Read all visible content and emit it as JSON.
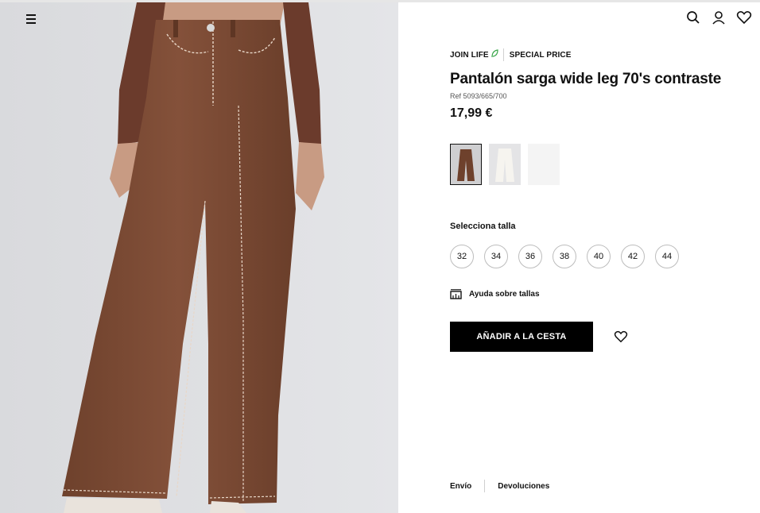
{
  "header": {
    "menu_icon": "hamburger-menu-icon",
    "icons": [
      "search-icon",
      "user-icon",
      "heart-icon"
    ]
  },
  "product": {
    "tags": [
      "JOIN LIFE",
      "SPECIAL PRICE"
    ],
    "title": "Pantalón sarga wide leg 70's contraste",
    "ref": "Ref 5093/665/700",
    "price": "17,99 €",
    "colors": [
      "brown",
      "white",
      "light-grey"
    ],
    "selected_color": "brown",
    "size_label": "Selecciona talla",
    "sizes": [
      "32",
      "34",
      "36",
      "38",
      "40",
      "42",
      "44"
    ],
    "size_help": "Ayuda sobre tallas",
    "add_to_cart": "AÑADIR A LA CESTA"
  },
  "footer": {
    "links": [
      "Envío",
      "Devoluciones"
    ]
  },
  "colors": {
    "pants_brown": "#7b4a33",
    "button_black": "#000000",
    "joinlife_green": "#3aa64a"
  }
}
